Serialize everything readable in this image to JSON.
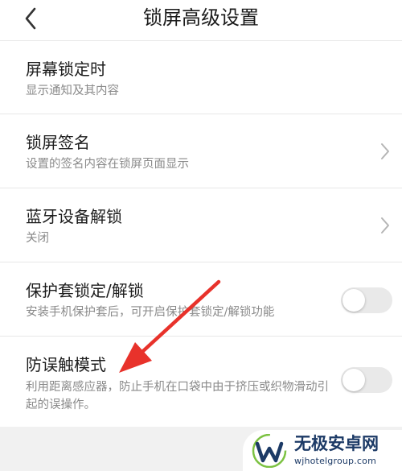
{
  "header": {
    "title": "锁屏高级设置",
    "back_icon": "chevron-left-icon"
  },
  "settings": [
    {
      "title": "屏幕锁定时",
      "subtitle": "显示通知及其内容",
      "control": "none"
    },
    {
      "title": "锁屏签名",
      "subtitle": "设置的签名内容在锁屏页面显示",
      "control": "chevron"
    },
    {
      "title": "蓝牙设备解锁",
      "subtitle": "关闭",
      "control": "chevron"
    },
    {
      "title": "保护套锁定/解锁",
      "subtitle": "安装手机保护套后，可开启保护套锁定/解锁功能",
      "control": "toggle",
      "enabled": false
    },
    {
      "title": "防误触模式",
      "subtitle": "利用距离感应器，防止手机在口袋中由于挤压或织物滑动引起的误操作。",
      "control": "toggle",
      "enabled": false
    }
  ],
  "annotation": {
    "arrow_color": "#e8322b"
  },
  "watermark": {
    "name": "无极安卓网",
    "url": "wjhotelgroup.com",
    "color": "#1c3a66",
    "accent": "#7cc242"
  }
}
